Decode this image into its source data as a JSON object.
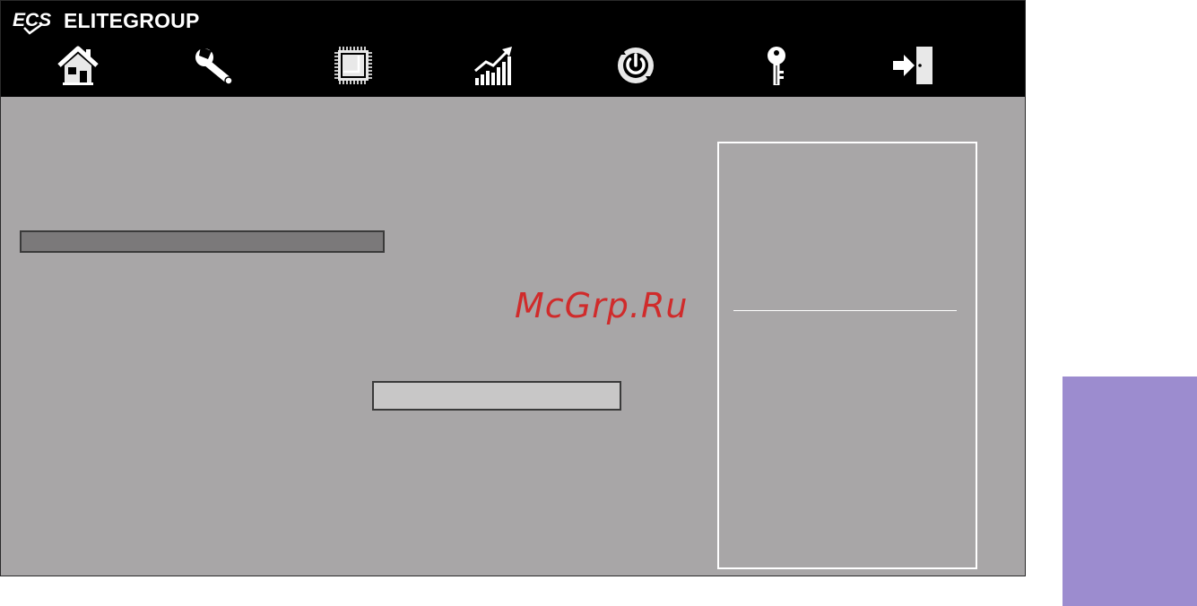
{
  "brand": {
    "name": "ELITEGROUP",
    "logo": "ECS",
    "logo_icon": "ecs-logo"
  },
  "nav": {
    "items": [
      {
        "id": "main",
        "icon": "home-icon"
      },
      {
        "id": "advanced",
        "icon": "wrench-icon"
      },
      {
        "id": "chipset",
        "icon": "chip-icon"
      },
      {
        "id": "performance",
        "icon": "performance-graph-icon"
      },
      {
        "id": "boot",
        "icon": "power-icon"
      },
      {
        "id": "security",
        "icon": "key-icon"
      },
      {
        "id": "exit",
        "icon": "exit-door-icon"
      }
    ]
  },
  "watermark": {
    "text": "McGrp.Ru"
  },
  "colors": {
    "topbar": "#000000",
    "content_bg": "#a8a6a7",
    "selected_bar": "#7b797a",
    "value_box": "#c8c7c7",
    "side_tab": "#9c8ccf",
    "watermark": "#d02b2b",
    "help_border": "#ffffff"
  }
}
